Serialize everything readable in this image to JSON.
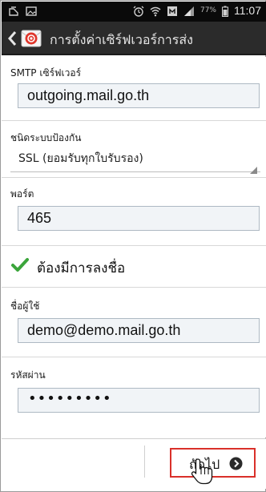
{
  "status_bar": {
    "battery_percent": "77%",
    "time": "11:07",
    "icons": [
      "sim-card-icon",
      "gallery-icon",
      "alarm-icon",
      "wifi-icon",
      "data-icon",
      "signal-icon",
      "battery-icon"
    ]
  },
  "header": {
    "title": "การตั้งค่าเซิร์ฟเวอร์การส่ง",
    "back_icon": "chevron-left-icon",
    "app_icon": "email-app-icon"
  },
  "form": {
    "smtp": {
      "label": "SMTP เซิร์ฟเวอร์",
      "value": "outgoing.mail.go.th"
    },
    "security": {
      "label": "ชนิดระบบป้องกัน",
      "value": "SSL (ยอมรับทุกใบรับรอง)"
    },
    "port": {
      "label": "พอร์ต",
      "value": "465"
    },
    "require_signin": {
      "label": "ต้องมีการลงชื่อ",
      "checked": true
    },
    "username": {
      "label": "ชื่อผู้ใช้",
      "value": "demo@demo.mail.go.th"
    },
    "password": {
      "label": "รหัสผ่าน",
      "value": "•••••••••"
    }
  },
  "footer": {
    "next_label": "ถัดไป",
    "highlight_color": "#d9302a"
  },
  "colors": {
    "status_bar": "#0a0a0a",
    "action_bar": "#2b2b2b",
    "input_background": "#f1f4f7",
    "checkbox": "#3ba53b"
  }
}
